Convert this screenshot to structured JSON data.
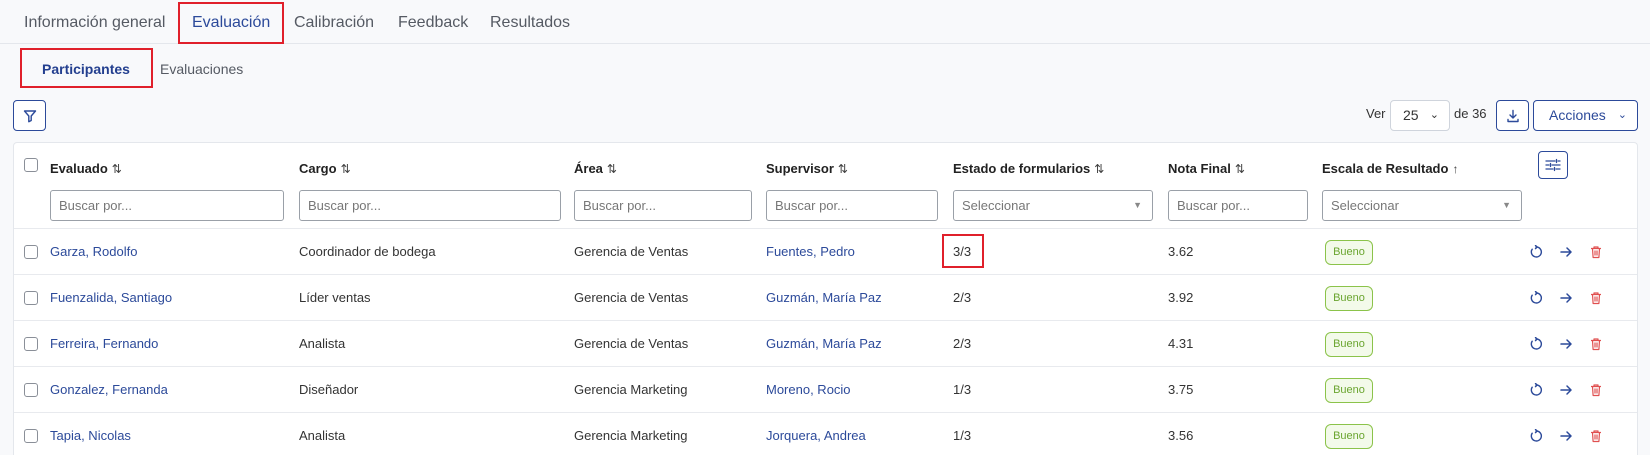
{
  "tabs": [
    "Información general",
    "Evaluación",
    "Calibración",
    "Feedback",
    "Resultados"
  ],
  "subtabs": [
    "Participantes",
    "Evaluaciones"
  ],
  "toolbar": {
    "ver_label": "Ver",
    "page_size": "25",
    "total_label": "de 36",
    "actions_label": "Acciones"
  },
  "columns": [
    {
      "label": "Evaluado",
      "sort": "⇅"
    },
    {
      "label": "Cargo",
      "sort": "⇅"
    },
    {
      "label": "Área",
      "sort": "⇅"
    },
    {
      "label": "Supervisor",
      "sort": "⇅"
    },
    {
      "label": "Estado de formularios",
      "sort": "⇅"
    },
    {
      "label": "Nota Final",
      "sort": "⇅"
    },
    {
      "label": "Escala de Resultado",
      "sort": "↑"
    }
  ],
  "filters": {
    "search_placeholder": "Buscar por...",
    "select_placeholder": "Seleccionar"
  },
  "rows": [
    {
      "evaluado": "Garza, Rodolfo",
      "cargo": "Coordinador de bodega",
      "area": "Gerencia de Ventas",
      "supervisor": "Fuentes, Pedro",
      "estado": "3/3",
      "nota": "3.62",
      "escala": "Bueno"
    },
    {
      "evaluado": "Fuenzalida, Santiago",
      "cargo": "Líder ventas",
      "area": "Gerencia de Ventas",
      "supervisor": "Guzmán, María Paz",
      "estado": "2/3",
      "nota": "3.92",
      "escala": "Bueno"
    },
    {
      "evaluado": "Ferreira, Fernando",
      "cargo": "Analista",
      "area": "Gerencia de Ventas",
      "supervisor": "Guzmán, María Paz",
      "estado": "2/3",
      "nota": "4.31",
      "escala": "Bueno"
    },
    {
      "evaluado": "Gonzalez, Fernanda",
      "cargo": "Diseñador",
      "area": "Gerencia Marketing",
      "supervisor": "Moreno, Rocio",
      "estado": "1/3",
      "nota": "3.75",
      "escala": "Bueno"
    },
    {
      "evaluado": "Tapia, Nicolas",
      "cargo": "Analista",
      "area": "Gerencia Marketing",
      "supervisor": "Jorquera, Andrea",
      "estado": "1/3",
      "nota": "3.56",
      "escala": "Bueno"
    }
  ],
  "icons": {
    "filter": "filter-icon",
    "download": "download-icon",
    "columns": "column-settings-icon",
    "reset": "reset-icon",
    "open": "arrow-right-icon",
    "delete": "trash-icon"
  },
  "colors": {
    "primary": "#2c4a9a",
    "highlight": "#e0202b",
    "badge_green": "#6aa52f",
    "delete_red": "#e05050"
  }
}
